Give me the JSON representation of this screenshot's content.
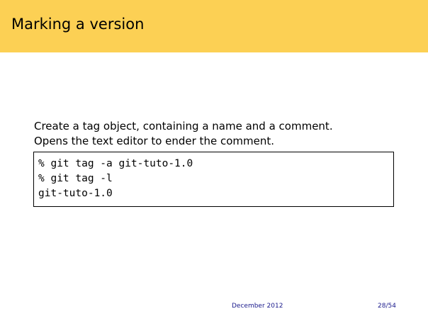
{
  "slide": {
    "title": "Marking a version",
    "paragraphs": [
      "Create a tag object, containing a name and a comment.",
      "Opens the text editor to ender the comment."
    ],
    "code_lines": [
      "% git tag -a git-tuto-1.0",
      "% git tag -l",
      "git-tuto-1.0"
    ]
  },
  "footer": {
    "date": "December 2012",
    "page": "28/54"
  },
  "colors": {
    "header_background": "#fcd054",
    "footer_text": "#1a1a8c"
  }
}
